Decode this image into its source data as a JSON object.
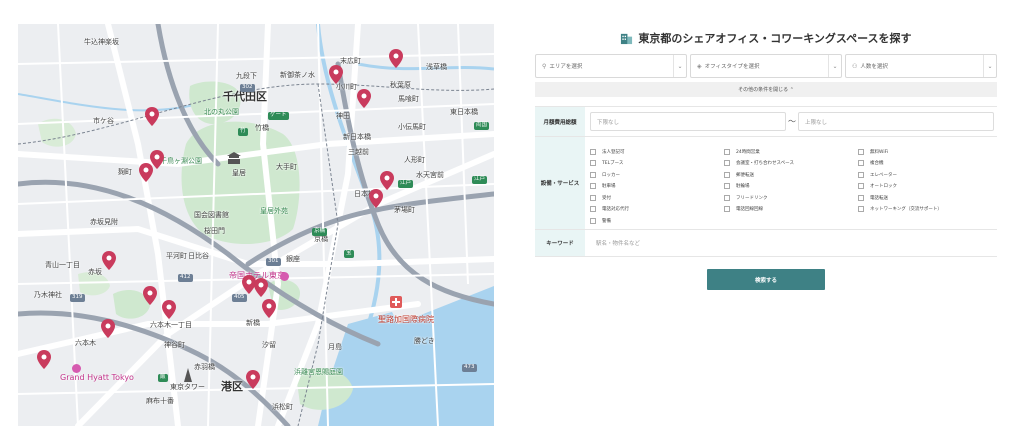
{
  "map": {
    "labels": {
      "ushigome": "牛込神楽坂",
      "kudanshita": "九段下",
      "shinochanomizu": "新御茶ノ水",
      "suehirocho": "末広町",
      "akihabara": "秋葉原",
      "asakusabashi": "浅草橋",
      "ogawamachi": "小川町",
      "chiyoda": "千代田区",
      "kanda": "神田",
      "bakurocho": "馬喰町",
      "ichigaya": "市ケ谷",
      "takebashi": "竹橋",
      "shinnihonbashi": "新日本橋",
      "kodenmacho": "小伝馬町",
      "higashinihonbashi": "東日本橋",
      "mitsukoshimae": "三越前",
      "chidorigafuchi": "千鳥ヶ淵公園",
      "kokyo": "皇居",
      "otemachi": "大手町",
      "ningyocho": "人形町",
      "kojimachi": "麹町",
      "nihonbashi": "日本橋",
      "suitengumae": "水天宮前",
      "kayabacho": "茅場町",
      "kokyogaien": "皇居外苑",
      "kokkai": "国会図書館",
      "akasakamitsuke": "赤坂見附",
      "sakuradamon": "桜田門",
      "kyobashi": "京橋",
      "hibiya": "日比谷",
      "ginza": "銀座",
      "akasaka": "赤坂",
      "aoyama": "青山一丁目",
      "nogizaka": "乃木神社",
      "roppongi1": "六本木一丁目",
      "roppongi": "六本木",
      "shinbashi": "新橋",
      "kamiyacho": "神谷町",
      "tokyotower": "東京タワー",
      "minato": "港区",
      "shiodome": "汐留",
      "kachidoki": "勝どき",
      "tsukishima": "月島",
      "hamarikyu": "浜離宮恩賜庭園",
      "akabanebashi": "赤羽橋",
      "hamamatsucho": "浜松町",
      "azabujuban": "麻布十番",
      "hospital": "聖路加国際病院",
      "hotel": "帝国ホテル東京",
      "grandhyatt": "Grand Hyatt Tokyo",
      "kitanomaru": "北の丸公園",
      "hirakawacho": "平河町",
      "hotel2": "ホテル"
    }
  },
  "search": {
    "title": "東京都のシェアオフィス・コワーキングスペースを探す",
    "area_placeholder": "エリアを選択",
    "type_placeholder": "オフィスタイプを選択",
    "people_placeholder": "人数を選択",
    "more_conditions": "その他の条件を開じる ⌃",
    "price_label": "月額費用総額",
    "price_min": "下限なし",
    "price_max": "上限なし",
    "tilde": "〜",
    "services_label": "設備・サービス",
    "services": [
      "法人登記可",
      "24時間営業",
      "無料WiFi",
      "TELブース",
      "会議室・打ち合わせスペース",
      "複合機",
      "ロッカー",
      "郵便転送",
      "エレベーター",
      "駐車場",
      "駐輪場",
      "オートロック",
      "受付",
      "フリードリンク",
      "電話転送",
      "電話対応代行",
      "電話回線回線",
      "ネットワーキング（交流サポート）",
      "警備"
    ],
    "keyword_label": "キーワード",
    "keyword_placeholder": "駅名・物件名など",
    "submit": "検索する"
  },
  "colors": {
    "accent": "#3e8185",
    "label_bg": "#e9f5f5",
    "pin": "#c93b5d"
  }
}
